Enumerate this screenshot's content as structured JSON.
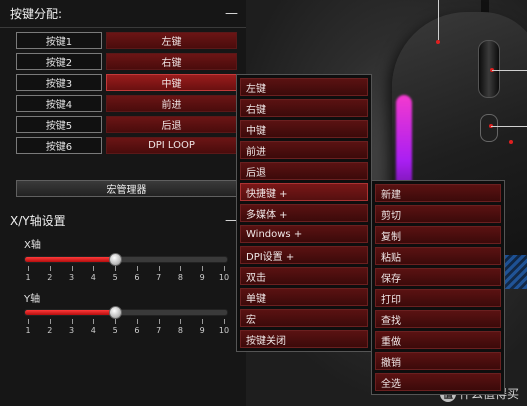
{
  "key_assignment": {
    "title": "按键分配:",
    "collapse_symbol": "—",
    "rows": [
      {
        "key": "按键1",
        "action": "左键"
      },
      {
        "key": "按键2",
        "action": "右键"
      },
      {
        "key": "按键3",
        "action": "中键"
      },
      {
        "key": "按键4",
        "action": "前进"
      },
      {
        "key": "按键5",
        "action": "后退"
      },
      {
        "key": "按键6",
        "action": "DPI LOOP"
      }
    ]
  },
  "macro_manager_label": "宏管理器",
  "xy_axis": {
    "title": "X/Y轴设置",
    "collapse_symbol": "—",
    "x_label": "X轴",
    "y_label": "Y轴",
    "x_value": 5,
    "y_value": 5,
    "scale": [
      "1",
      "2",
      "3",
      "4",
      "5",
      "6",
      "7",
      "8",
      "9",
      "10"
    ]
  },
  "context_menu": {
    "items": [
      "左键",
      "右键",
      "中键",
      "前进",
      "后退",
      "快捷键 +",
      "多媒体 +",
      "Windows +",
      "DPI设置 +",
      "双击",
      "单键",
      "宏",
      "按键关闭"
    ]
  },
  "shortcut_submenu": {
    "items": [
      "新建",
      "剪切",
      "复制",
      "粘贴",
      "保存",
      "打印",
      "查找",
      "重做",
      "撤销",
      "全选"
    ]
  },
  "watermark": {
    "badge": "值",
    "text": "什么值得买"
  },
  "colors": {
    "accent_red": "#9a1c1c",
    "glow": "#ff3bd8"
  }
}
